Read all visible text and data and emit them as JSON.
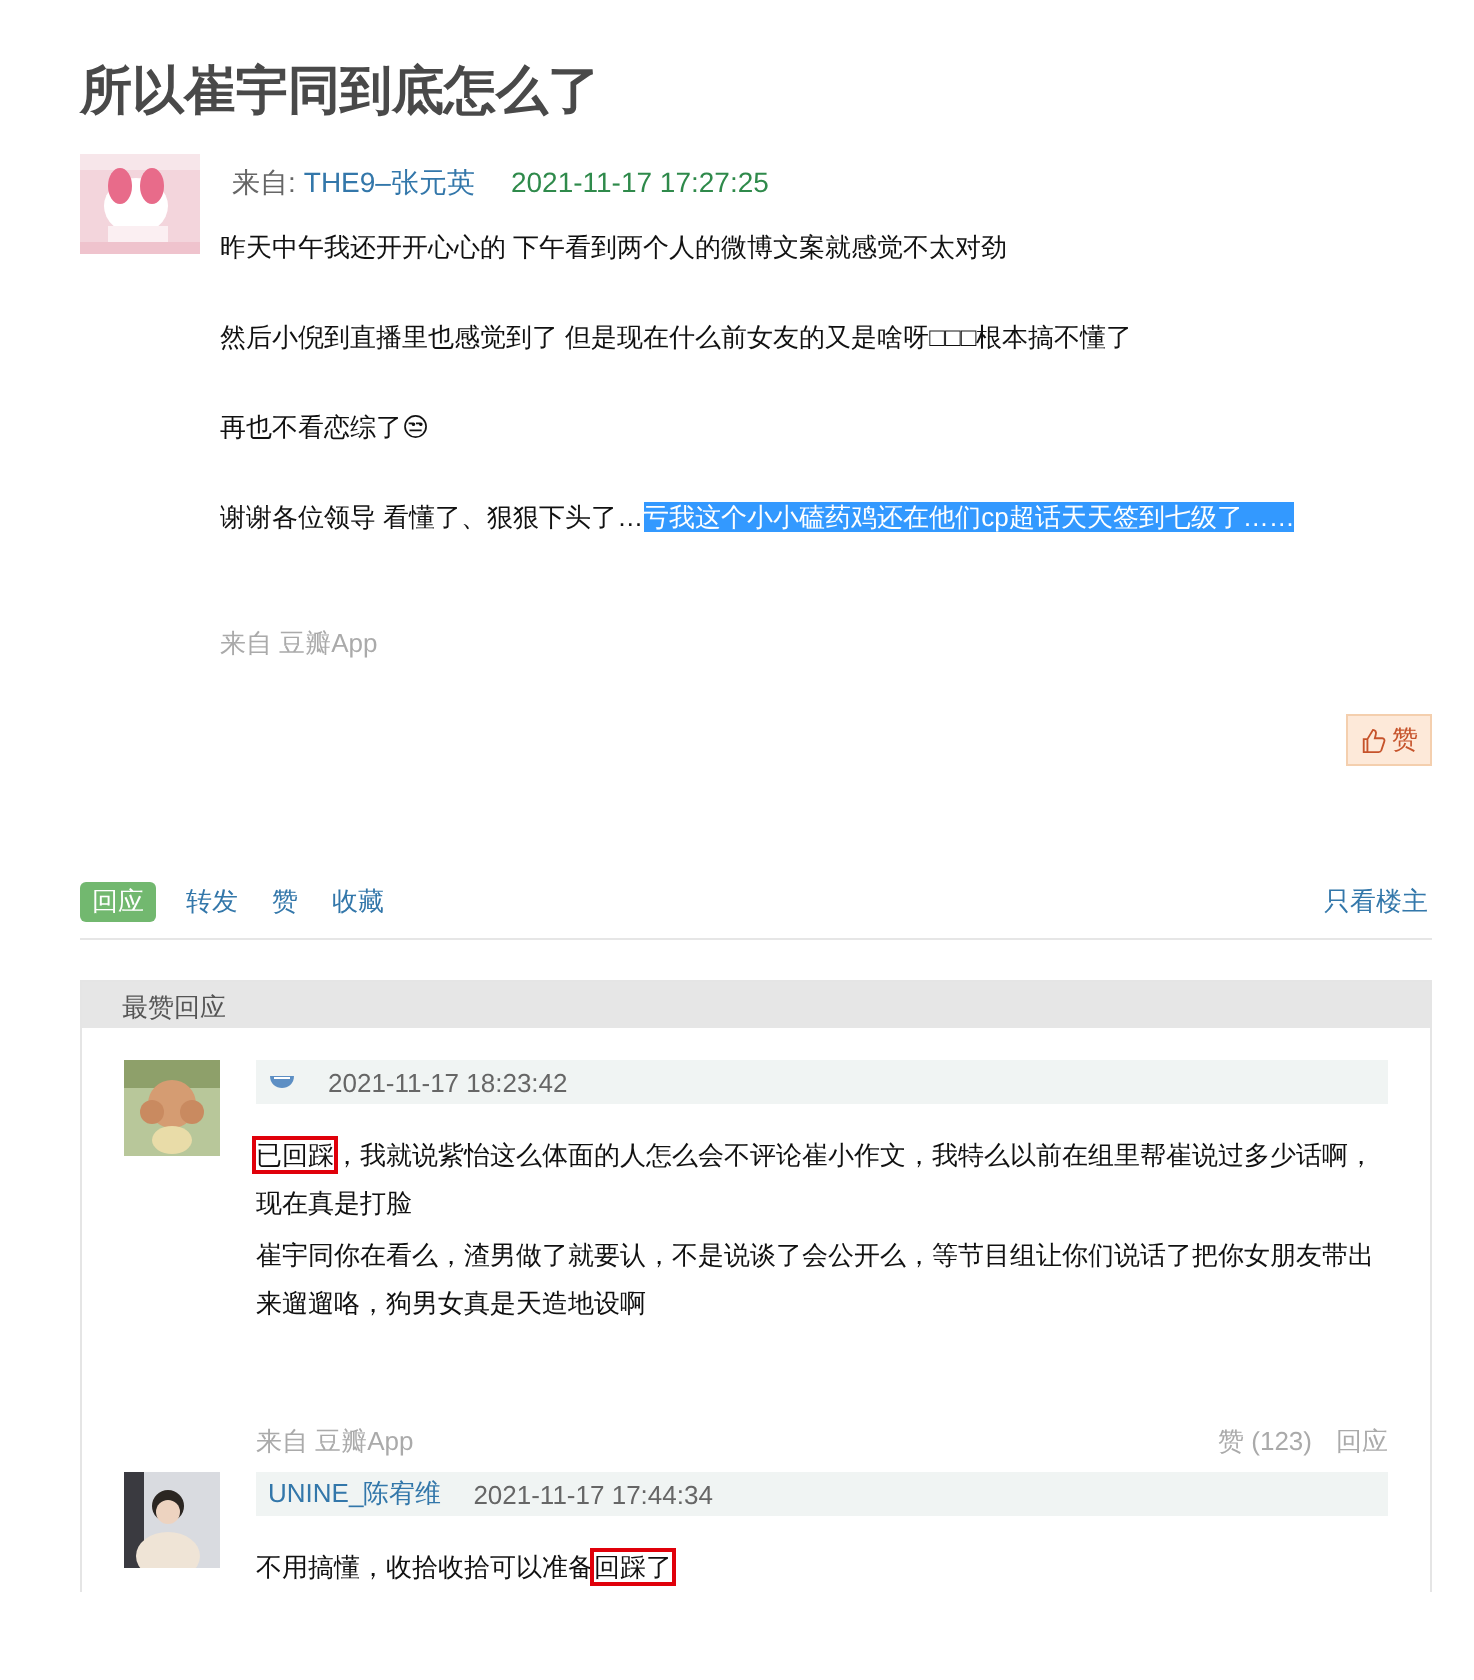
{
  "title": "所以崔宇同到底怎么了",
  "post": {
    "avatar": {
      "kind": "picture"
    },
    "from_label": "来自:",
    "author": "THE9–张元英",
    "time": "2021-11-17 17:27:25",
    "paragraphs": [
      [
        {
          "text": "昨天中午我还开开心心的 下午看到两个人的微博文案就感觉不太对劲",
          "selected": false
        }
      ],
      [
        {
          "text": "然后小倪到直播里也感觉到了 但是现在什么前女友的又是啥呀□□□根本搞不懂了",
          "selected": false
        }
      ],
      [
        {
          "text": "再也不看恋综了😒",
          "selected": false
        }
      ],
      [
        {
          "text": "谢谢各位领导 看懂了、狠狠下头了…",
          "selected": false
        },
        {
          "text": "亏我这个小小磕药鸡还在他们cp超话天天签到七级了……",
          "selected": true
        }
      ]
    ],
    "source": "来自 豆瓣App",
    "like_button": "赞"
  },
  "actions": [
    {
      "label": "回应",
      "primary": true
    },
    {
      "label": "转发",
      "primary": false
    },
    {
      "label": "赞",
      "primary": false
    },
    {
      "label": "收藏",
      "primary": false
    }
  ],
  "op_only": "只看楼主",
  "best_replies": {
    "header": "最赞回应",
    "replies": [
      {
        "kind": "icon",
        "time": "2021-11-17 18:23:42",
        "lines": [
          [
            {
              "text": "已回踩",
              "boxed": true
            },
            {
              "text": "，我就说紫怡这么体面的人怎么会不评论崔小作文，我特么以前在组里帮崔说过多少话啊，现在真是打脸",
              "boxed": false
            }
          ],
          [
            {
              "text": "崔宇同你在看么，渣男做了就要认，不是说谈了会公开么，等节目组让你们说话了把你女朋友带出来遛遛咯，狗男女真是天造地设啊",
              "boxed": false
            }
          ]
        ],
        "source": "来自 豆瓣App",
        "likes": "赞 (123)",
        "reply": "回应"
      },
      {
        "kind": "name",
        "author": "UNINE_陈宥维",
        "time": "2021-11-17 17:44:34",
        "lines": [
          [
            {
              "text": "不用搞懂，收拾收拾可以准备",
              "boxed": false
            },
            {
              "text": "回踩了",
              "boxed": true
            }
          ]
        ]
      }
    ]
  }
}
